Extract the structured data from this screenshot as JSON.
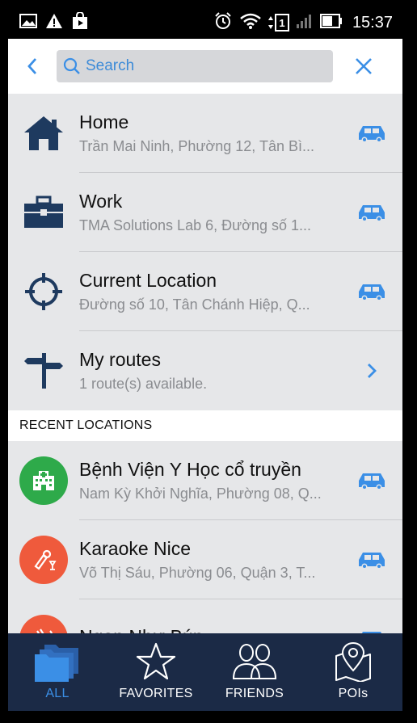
{
  "colors": {
    "accent": "#3b8fe6",
    "dark_blue": "#1e3a5f",
    "tabbar_bg": "#1b2a46",
    "green": "#2eaa4a",
    "red_orange": "#ef5a3c"
  },
  "status_bar": {
    "time": "15:37",
    "sim_slot": "1"
  },
  "search": {
    "placeholder": "Search"
  },
  "quick_items": [
    {
      "title": "Home",
      "subtitle": "Trần Mai Ninh, Phường 12,  Tân Bì...",
      "icon": "home-icon",
      "action": "car-icon"
    },
    {
      "title": "Work",
      "subtitle": "TMA Solutions Lab 6, Đường số 1...",
      "icon": "briefcase-icon",
      "action": "car-icon"
    },
    {
      "title": "Current Location",
      "subtitle": "Đường số 10,  Tân Chánh Hiệp,  Q...",
      "icon": "crosshair-icon",
      "action": "car-icon"
    },
    {
      "title": "My routes",
      "subtitle": "1 route(s) available.",
      "icon": "signpost-icon",
      "action": "chevron-right-icon"
    }
  ],
  "recent_header": "RECENT LOCATIONS",
  "recent_items": [
    {
      "title": "Bệnh Viện Y Học cổ truyền",
      "subtitle": "Nam Kỳ Khởi Nghĩa, Phường 08, Q...",
      "icon": "hospital-icon"
    },
    {
      "title": "Karaoke Nice",
      "subtitle": "Võ Thị Sáu, Phường 06, Quận 3, T...",
      "icon": "karaoke-icon"
    },
    {
      "title": "Ngon Như Bún",
      "subtitle": "",
      "icon": "restaurant-icon"
    }
  ],
  "tabs": [
    {
      "label": "ALL",
      "icon": "folders-icon",
      "active": true
    },
    {
      "label": "FAVORITES",
      "icon": "star-icon",
      "active": false
    },
    {
      "label": "FRIENDS",
      "icon": "friends-icon",
      "active": false
    },
    {
      "label": "POIs",
      "icon": "map-pin-icon",
      "active": false
    }
  ]
}
